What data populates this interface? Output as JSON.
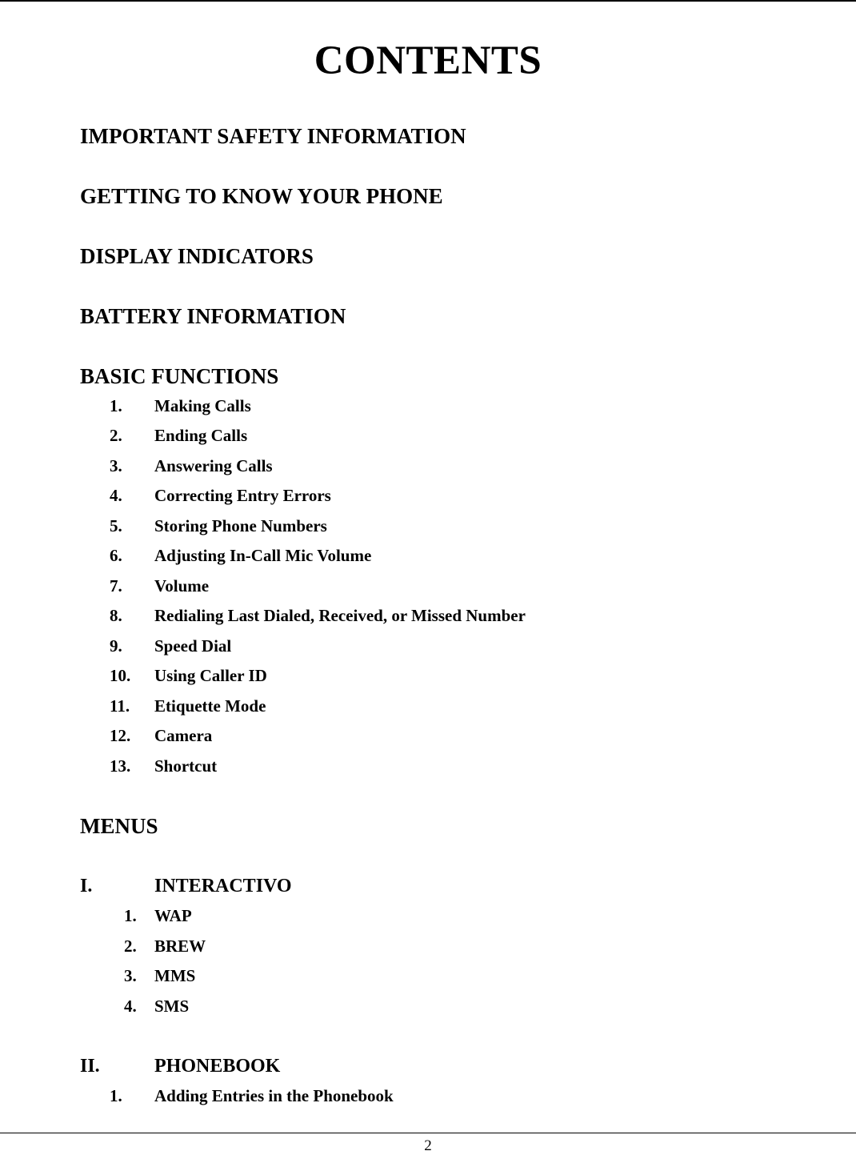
{
  "page": {
    "title": "CONTENTS",
    "page_number": "2"
  },
  "sections": [
    {
      "label": "IMPORTANT SAFETY INFORMATION"
    },
    {
      "label": "GETTING TO KNOW YOUR PHONE"
    },
    {
      "label": "DISPLAY INDICATORS"
    },
    {
      "label": "BATTERY INFORMATION"
    },
    {
      "label": "BASIC FUNCTIONS",
      "items": [
        {
          "num": "1.",
          "label": "Making Calls"
        },
        {
          "num": "2.",
          "label": "Ending Calls"
        },
        {
          "num": "3.",
          "label": "Answering Calls"
        },
        {
          "num": "4.",
          "label": "Correcting Entry Errors"
        },
        {
          "num": "5.",
          "label": "Storing Phone Numbers"
        },
        {
          "num": "6.",
          "label": "Adjusting In-Call Mic Volume"
        },
        {
          "num": "7.",
          "label": "Volume"
        },
        {
          "num": "8.",
          "label": "Redialing Last Dialed, Received, or Missed Number"
        },
        {
          "num": "9.",
          "label": "Speed Dial"
        },
        {
          "num": "10.",
          "label": "Using Caller ID"
        },
        {
          "num": "11.",
          "label": "Etiquette Mode"
        },
        {
          "num": "12.",
          "label": "Camera"
        },
        {
          "num": "13.",
          "label": "Shortcut"
        }
      ]
    },
    {
      "label": "MENUS",
      "subsections": [
        {
          "num": "I.",
          "label": "INTERACTIVO",
          "items": [
            {
              "num": "1.",
              "label": "WAP"
            },
            {
              "num": "2.",
              "label": "BREW"
            },
            {
              "num": "3.",
              "label": "MMS"
            },
            {
              "num": "4.",
              "label": "SMS"
            }
          ]
        },
        {
          "num": "II.",
          "label": "PHONEBOOK",
          "items": [
            {
              "num": "1.",
              "label": "Adding Entries in the Phonebook"
            }
          ]
        }
      ]
    }
  ]
}
